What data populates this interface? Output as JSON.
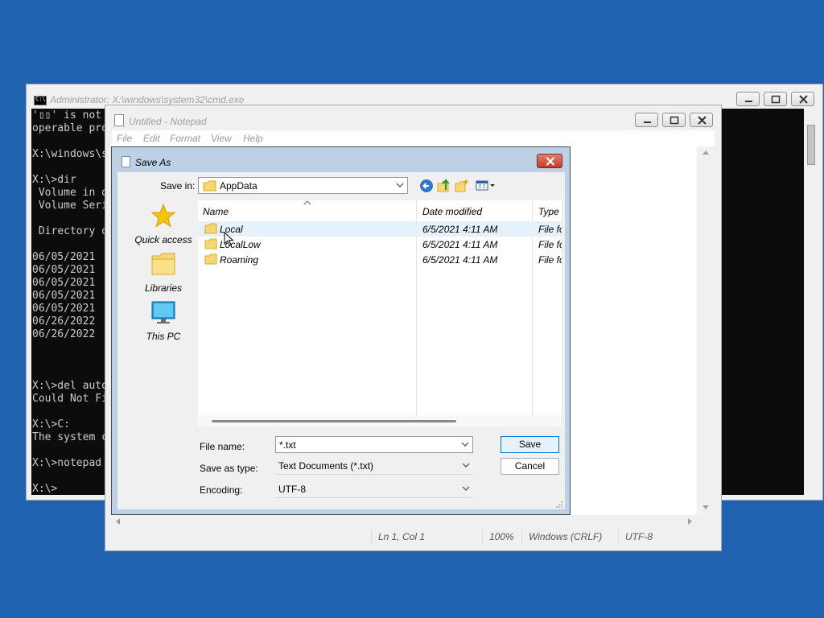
{
  "cmd": {
    "title": "Administrator: X:\\windows\\system32\\cmd.exe",
    "lines": [
      "'▯▯' is not",
      "operable pro",
      "",
      "X:\\windows\\s",
      "",
      "X:\\>dir",
      " Volume in d",
      " Volume Seri",
      "",
      " Directory o",
      "",
      "06/05/2021",
      "06/05/2021",
      "06/05/2021",
      "06/05/2021",
      "06/05/2021",
      "06/26/2022",
      "06/26/2022",
      "",
      "",
      "",
      "X:\\>del auto",
      "Could Not Fi",
      "",
      "X:\\>C:",
      "The system c",
      "",
      "X:\\>notepad",
      "",
      "X:\\>"
    ]
  },
  "notepad": {
    "title": "Untitled - Notepad",
    "menu": [
      "File",
      "Edit",
      "Format",
      "View",
      "Help"
    ],
    "status": {
      "position": "Ln 1, Col 1",
      "zoom": "100%",
      "line_ending": "Windows (CRLF)",
      "encoding": "UTF-8"
    }
  },
  "dialog": {
    "title": "Save As",
    "save_in_label": "Save in:",
    "save_in_value": "AppData",
    "places": [
      "Quick access",
      "Libraries",
      "This PC"
    ],
    "columns": {
      "name": "Name",
      "date": "Date modified",
      "type": "Type"
    },
    "files": [
      {
        "name": "Local",
        "date": "6/5/2021 4:11 AM",
        "type": "File fo"
      },
      {
        "name": "LocalLow",
        "date": "6/5/2021 4:11 AM",
        "type": "File fo"
      },
      {
        "name": "Roaming",
        "date": "6/5/2021 4:11 AM",
        "type": "File fo"
      }
    ],
    "file_name_label": "File name:",
    "file_name_value": "*.txt",
    "save_as_type_label": "Save as type:",
    "save_as_type_value": "Text Documents (*.txt)",
    "encoding_label": "Encoding:",
    "encoding_value": "UTF-8",
    "save_button": "Save",
    "cancel_button": "Cancel"
  },
  "colors": {
    "desktop": "#1e62b0",
    "console_bg": "#0c0c0c",
    "console_text": "#cccccc",
    "close_red": "#c73a28",
    "selection": "#e5f1fb"
  }
}
